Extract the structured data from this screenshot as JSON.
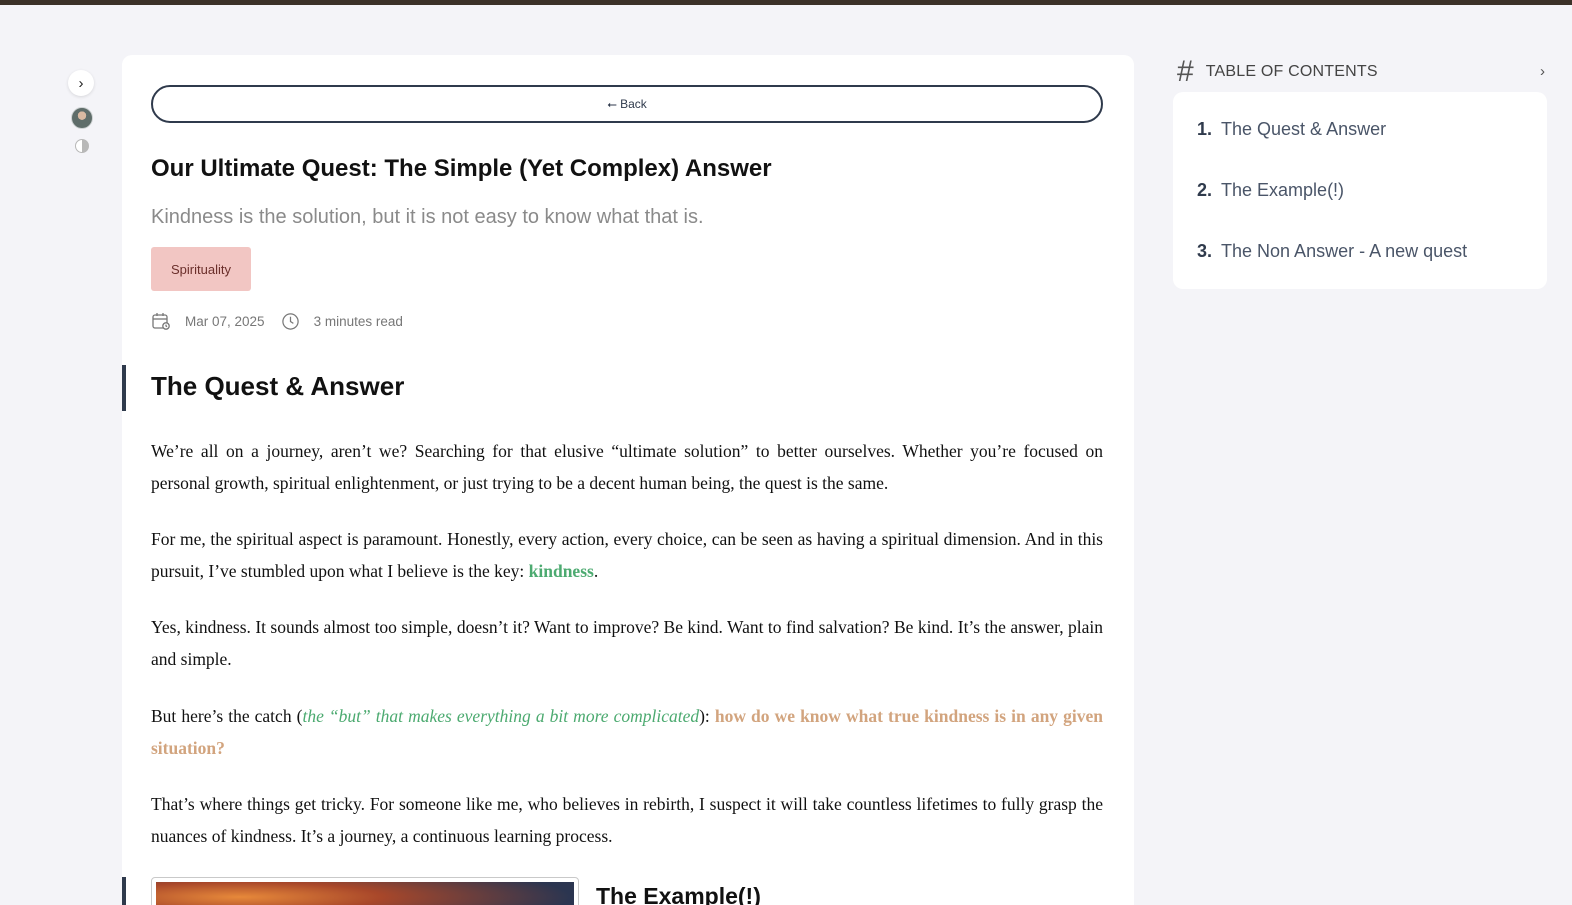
{
  "sidebar": {
    "toggle": "›"
  },
  "article": {
    "back_label": "⭠ Back",
    "title": "Our Ultimate Quest: The Simple (Yet Complex) Answer",
    "subtitle": "Kindness is the solution, but it is not easy to know what that is.",
    "tag": "Spirituality",
    "date": "Mar 07, 2025",
    "read_time": "3 minutes read",
    "section1_heading": "The Quest & Answer",
    "p1": "We’re all on a journey, aren’t we? Searching for that elusive “ultimate solution” to better ourselves. Whether you’re focused on personal growth, spiritual enlightenment, or just trying to be a decent human being, the quest is the same.",
    "p2_text": "For me, the spiritual aspect is paramount. Honestly, every action, every choice, can be seen as having a spiritual dimension. And in this pursuit, I’ve stumbled upon what I believe is the key: ",
    "p2_highlight": "kindness",
    "p2_end": ".",
    "p3": "Yes, kindness. It sounds almost too simple, doesn’t it? Want to improve? Be kind. Want to find salvation? Be kind. It’s the answer, plain and simple.",
    "p4_start": "But here’s the catch (",
    "p4_aside": "the “but” that makes everything a bit more complicated",
    "p4_mid": "): ",
    "p4_question": "how do we know what true kindness is in any given situation?",
    "p5": "That’s where things get tricky. For someone like me, who believes in rebirth, I suspect it will take countless lifetimes to fully grasp the nuances of kindness. It’s a journey, a continuous learning process.",
    "section2_heading": "The Example(!)"
  },
  "toc": {
    "hash": "#",
    "title": "TABLE OF CONTENTS",
    "chevron": "›",
    "items": [
      {
        "num": "1.",
        "label": "The Quest & Answer"
      },
      {
        "num": "2.",
        "label": "The Example(!)"
      },
      {
        "num": "3.",
        "label": "The Non Answer - A new quest"
      }
    ]
  },
  "colors": {
    "accent_dark": "#2f3a4c",
    "highlight_green": "#4caa70",
    "highlight_tan": "#d2a47e",
    "tag_bg": "#f2c6c3"
  },
  "icons": [
    "calendar-icon",
    "clock-icon",
    "avatar",
    "theme-toggle-icon"
  ]
}
